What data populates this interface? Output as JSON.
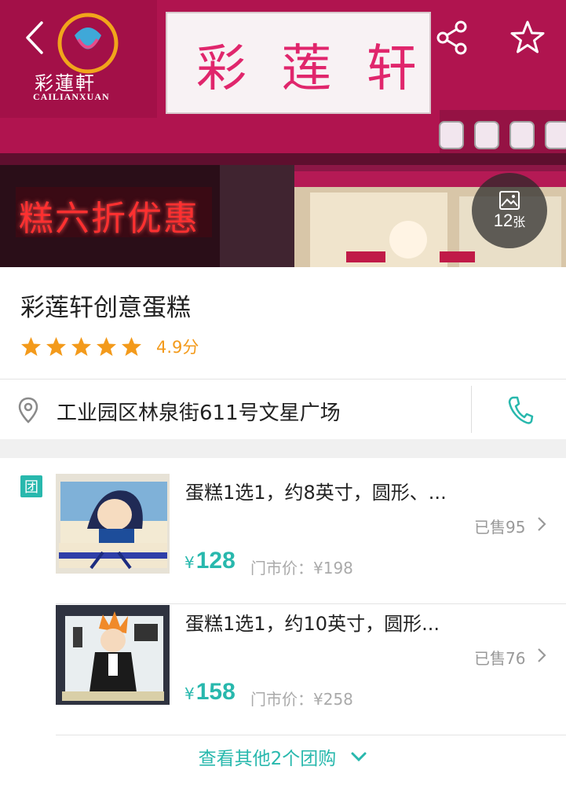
{
  "hero": {
    "logo_text": "彩蓮軒",
    "logo_sub": "CAILIANXUAN",
    "sign_text": "彩 莲 轩",
    "led_text": "糕六折优惠",
    "photo_count": "12",
    "photo_unit": "张",
    "colors": {
      "facade": "#b0144f",
      "led": "#ff2a2a"
    }
  },
  "shop": {
    "name": "彩莲轩创意蛋糕",
    "stars": 5,
    "score": "4.9分",
    "address": "工业园区林泉街611号文星广场"
  },
  "deals": {
    "tag": "团",
    "items": [
      {
        "title": "蛋糕1选1，约8英寸，圆形、...",
        "sold": "已售95",
        "currency": "¥",
        "price": "128",
        "original": "门市价：¥198"
      },
      {
        "title": "蛋糕1选1，约10英寸，圆形...",
        "sold": "已售76",
        "currency": "¥",
        "price": "158",
        "original": "门市价：¥258"
      }
    ],
    "more_label": "查看其他2个团购"
  },
  "icons": [
    "back-icon",
    "share-icon",
    "favorite-star-icon",
    "image-icon",
    "location-pin-icon",
    "phone-icon",
    "chevron-right-icon",
    "chevron-down-icon"
  ],
  "accent_color": "#28b8ad",
  "rating_color": "#f39a1b"
}
